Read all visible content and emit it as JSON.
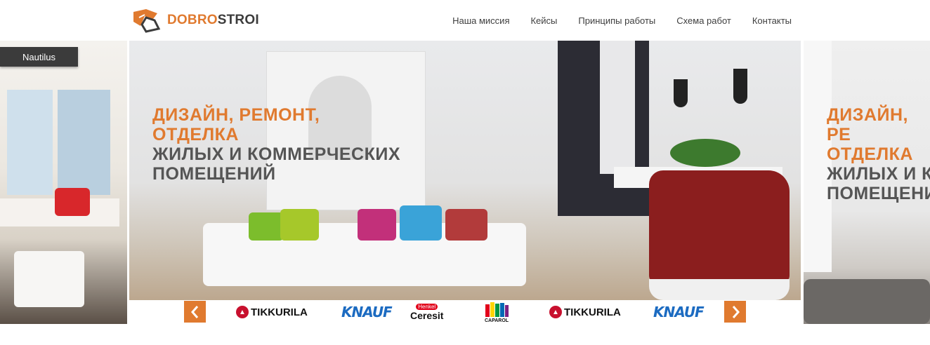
{
  "header": {
    "logo_part1": "DOBRO",
    "logo_part2": "STROI",
    "nav": [
      "Наша миссия",
      "Кейсы",
      "Принципы работы",
      "Схема работ",
      "Контакты"
    ]
  },
  "slider": {
    "ribbon": "Nautilus",
    "headline": {
      "line1": "ДИЗАЙН, РЕМОНТ,",
      "line2": "ОТДЕЛКА",
      "line3": "ЖИЛЫХ И КОММЕРЧЕСКИХ",
      "line4": "ПОМЕЩЕНИЙ"
    },
    "headline_right": {
      "line1": "ДИЗАЙН, РЕ",
      "line2": "ОТДЕЛКА",
      "line3": "ЖИЛЫХ И К",
      "line4": "ПОМЕЩЕНИ"
    }
  },
  "brands": {
    "tikkurila": "TIKKURILA",
    "knauf": "KNAUF",
    "henkel": "Henkel",
    "ceresit": "Ceresit",
    "caparol": "CAPAROL"
  },
  "colors": {
    "accent": "#e07a2f",
    "dark": "#3b3b3b"
  }
}
